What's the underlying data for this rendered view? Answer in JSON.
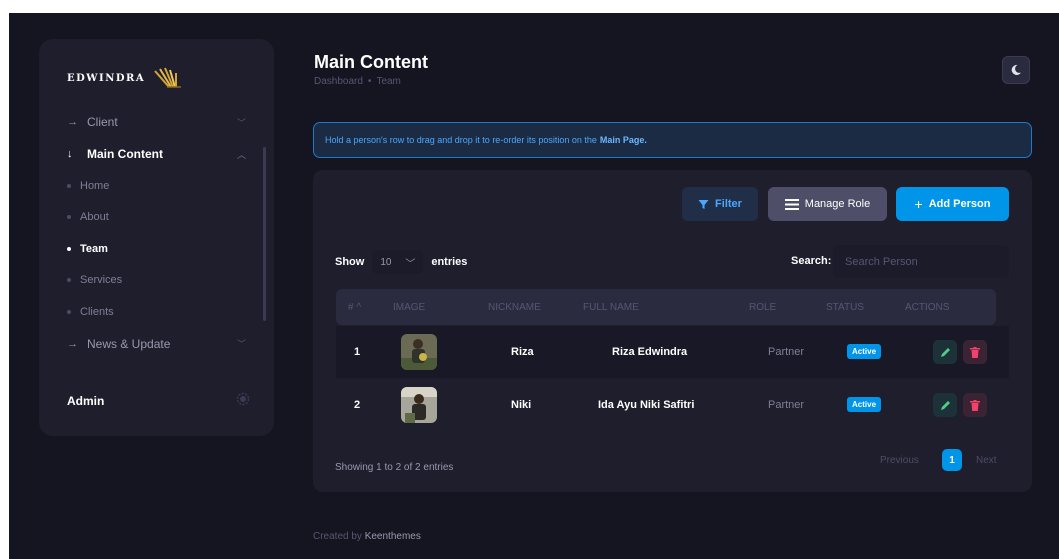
{
  "sidebar": {
    "logo_text": "EDWINDRA",
    "items": [
      {
        "label": "Client",
        "arrow": "→",
        "expanded": false
      },
      {
        "label": "Main Content",
        "arrow": "↓",
        "expanded": true
      },
      {
        "label": "News & Update",
        "arrow": "→",
        "expanded": false
      }
    ],
    "sub_items": [
      "Home",
      "About",
      "Team",
      "Services",
      "Clients"
    ],
    "active_sub": "Team",
    "admin_label": "Admin"
  },
  "header": {
    "title": "Main Content",
    "breadcrumb": [
      "Dashboard",
      "Team"
    ]
  },
  "notice": {
    "text": "Hold a person's row to drag and drop it to re-order its position on the",
    "link": "Main Page."
  },
  "toolbar": {
    "filter_label": "Filter",
    "manage_role_label": "Manage Role",
    "add_person_label": "Add Person"
  },
  "table_controls": {
    "show_label": "Show",
    "entries_value": "10",
    "entries_label": "entries",
    "search_label": "Search:",
    "search_placeholder": "Search Person"
  },
  "table": {
    "columns": [
      "# ^",
      "IMAGE",
      "NICKNAME",
      "FULL NAME",
      "ROLE",
      "STATUS",
      "ACTIONS"
    ],
    "rows": [
      {
        "num": "1",
        "nickname": "Riza",
        "full_name": "Riza Edwindra",
        "role": "Partner",
        "status": "Active"
      },
      {
        "num": "2",
        "nickname": "Niki",
        "full_name": "Ida Ayu Niki Safitri",
        "role": "Partner",
        "status": "Active"
      }
    ]
  },
  "pagination": {
    "summary": "Showing 1 to 2 of 2 entries",
    "prev": "Previous",
    "current": "1",
    "next": "Next"
  },
  "footer": {
    "prefix": "Created by",
    "link": "Keenthemes"
  },
  "colors": {
    "accent": "#0095e8",
    "background": "#151521",
    "card": "#1e1e2d"
  }
}
